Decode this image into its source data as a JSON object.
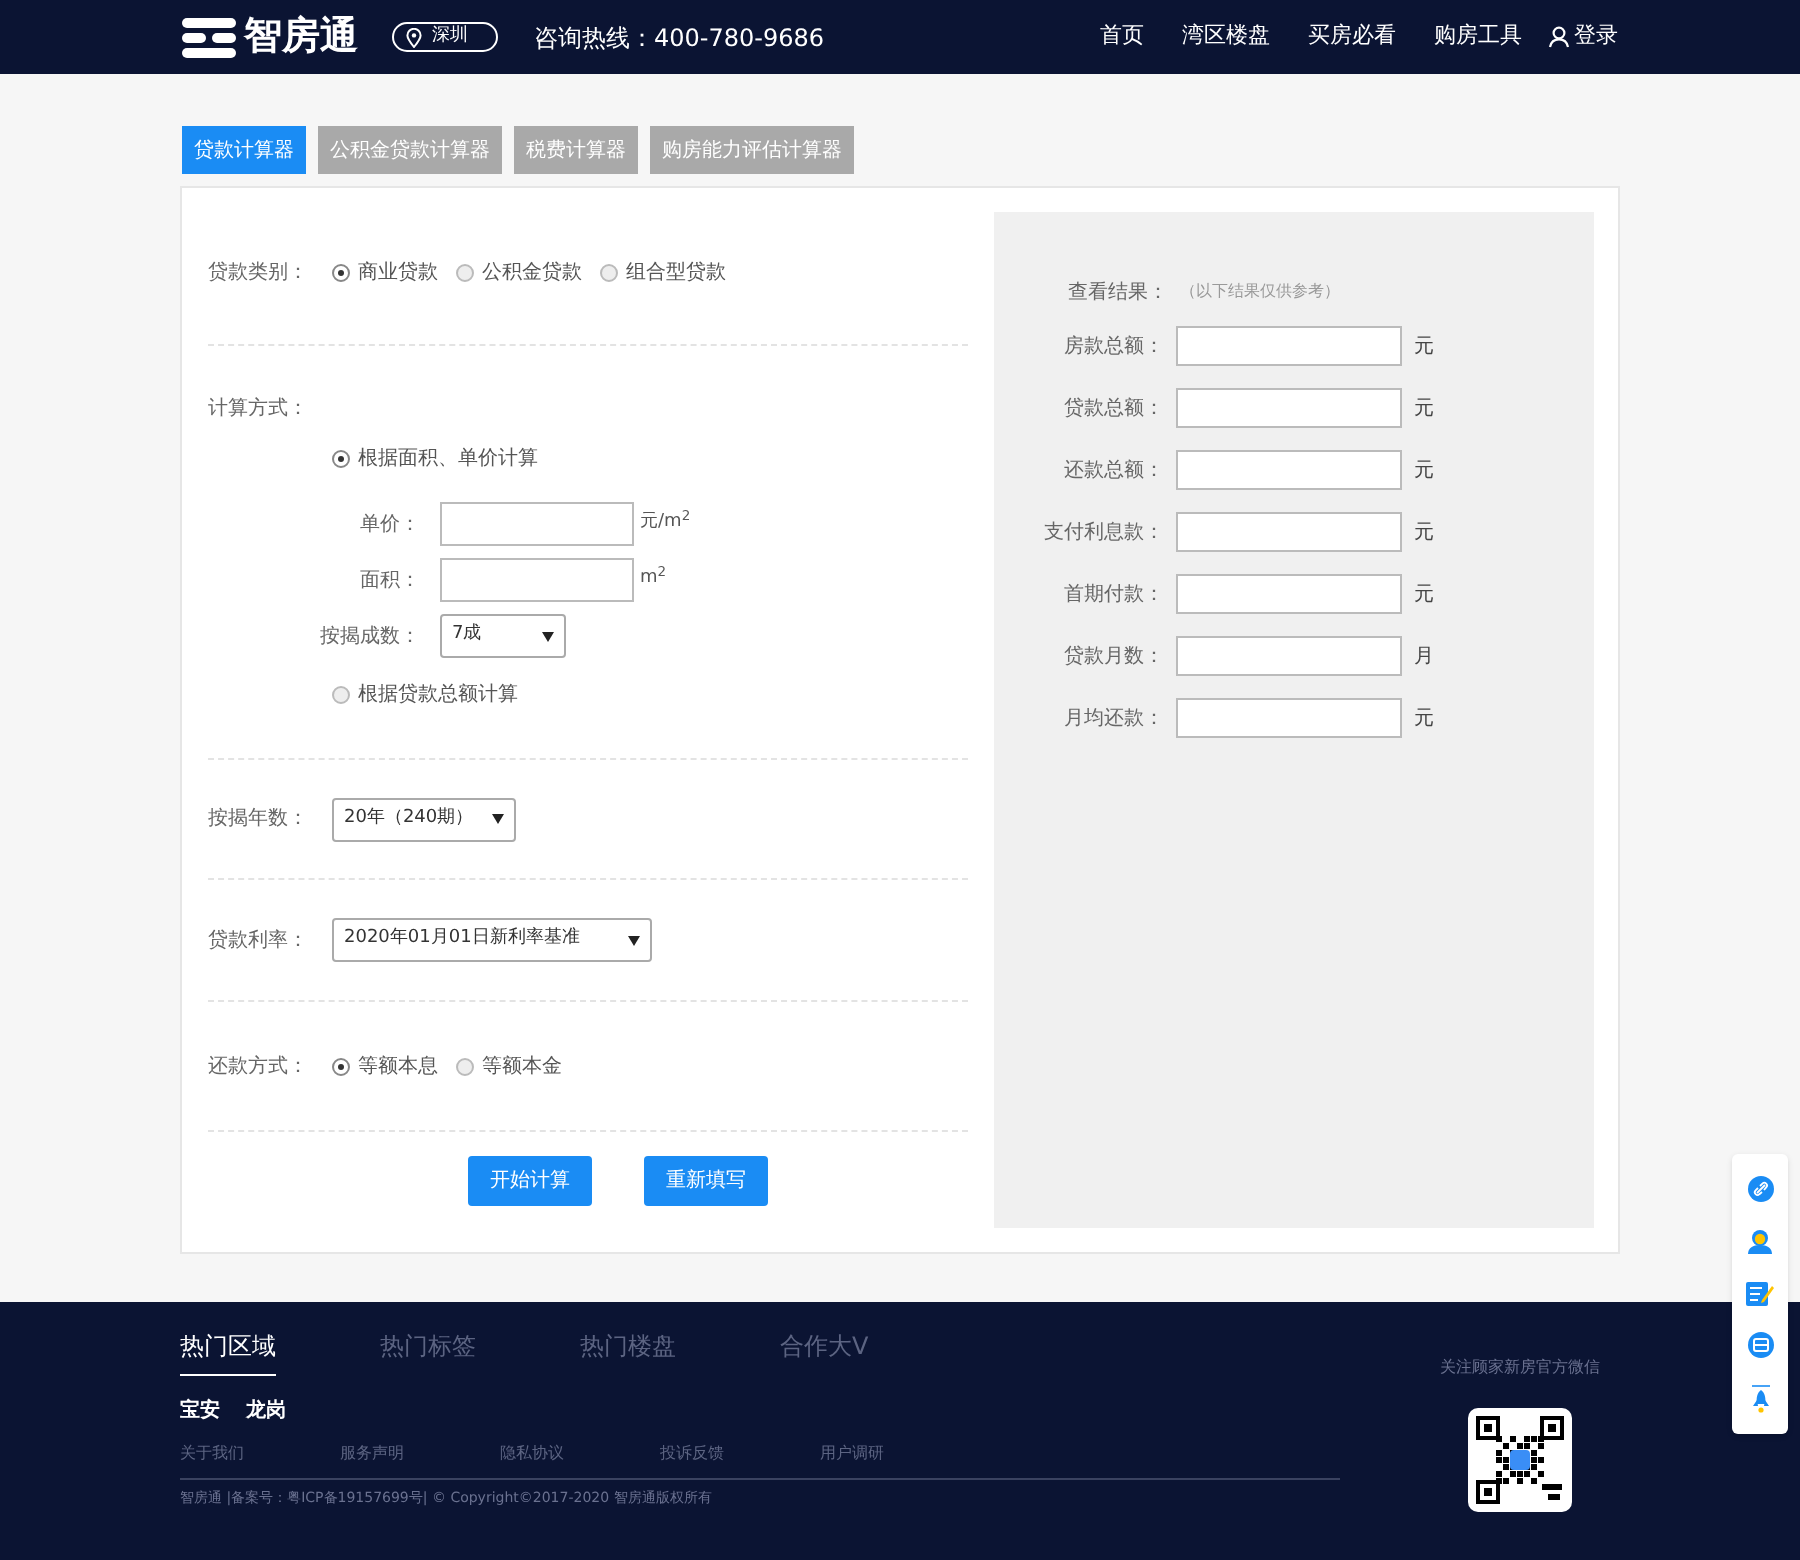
{
  "header": {
    "logo": "智房通",
    "city": "深圳",
    "hotline": "咨询热线：400-780-9686",
    "nav": [
      "首页",
      "湾区楼盘",
      "买房必看",
      "购房工具"
    ],
    "login": "登录"
  },
  "tabs": [
    {
      "label": "贷款计算器",
      "selected": true
    },
    {
      "label": "公积金贷款计算器",
      "selected": false
    },
    {
      "label": "税费计算器",
      "selected": false
    },
    {
      "label": "购房能力评估计算器",
      "selected": false
    }
  ],
  "loan_type": {
    "label": "贷款类别：",
    "options": [
      {
        "label": "商业贷款",
        "selected": true
      },
      {
        "label": "公积金贷款",
        "selected": false
      },
      {
        "label": "组合型贷款",
        "selected": false
      }
    ]
  },
  "calc_method": {
    "label": "计算方式：",
    "by_area": {
      "label": "根据面积、单价计算",
      "selected": true
    },
    "unit_price": {
      "label": "单价：",
      "unit": "元/m$^{2}$"
    },
    "area": {
      "label": "面积：",
      "unit": "m$^{2}$"
    },
    "down_payment": {
      "label": "按揭成数：",
      "value": "7成"
    },
    "by_total": {
      "label": "根据贷款总额计算",
      "selected": false
    }
  },
  "years": {
    "label": "按揭年数：",
    "value": "20年（240期）"
  },
  "rate": {
    "label": "贷款利率：",
    "value": "2020年01月01日新利率基准"
  },
  "repay": {
    "label": "还款方式：",
    "options": [
      {
        "label": "等额本息",
        "selected": true
      },
      {
        "label": "等额本金",
        "selected": false
      }
    ]
  },
  "buttons": [
    "开始计算",
    "重新填写"
  ],
  "results": {
    "title": "查看结果：",
    "note": "（以下结果仅供参考）",
    "rows": [
      {
        "label": "房款总额：",
        "unit": "元"
      },
      {
        "label": "贷款总额：",
        "unit": "元"
      },
      {
        "label": "还款总额：",
        "unit": "元"
      },
      {
        "label": "支付利息款：",
        "unit": "元"
      },
      {
        "label": "首期付款：",
        "unit": "元"
      },
      {
        "label": "贷款月数：",
        "unit": "月"
      },
      {
        "label": "月均还款：",
        "unit": "元"
      }
    ]
  },
  "footer": {
    "tabs": [
      {
        "label": "热门区域",
        "selected": true
      },
      {
        "label": "热门标签",
        "selected": false
      },
      {
        "label": "热门楼盘",
        "selected": false
      },
      {
        "label": "合作大V",
        "selected": false
      }
    ],
    "areas": [
      "宝安",
      "龙岗"
    ],
    "links": [
      "关于我们",
      "服务声明",
      "隐私协议",
      "投诉反馈",
      "用户调研"
    ],
    "copyright": "智房通 |备案号：粤ICP备19157699号| © Copyright©2017-2020 智房通版权所有",
    "wechat": "关注顾家新房官方微信"
  }
}
